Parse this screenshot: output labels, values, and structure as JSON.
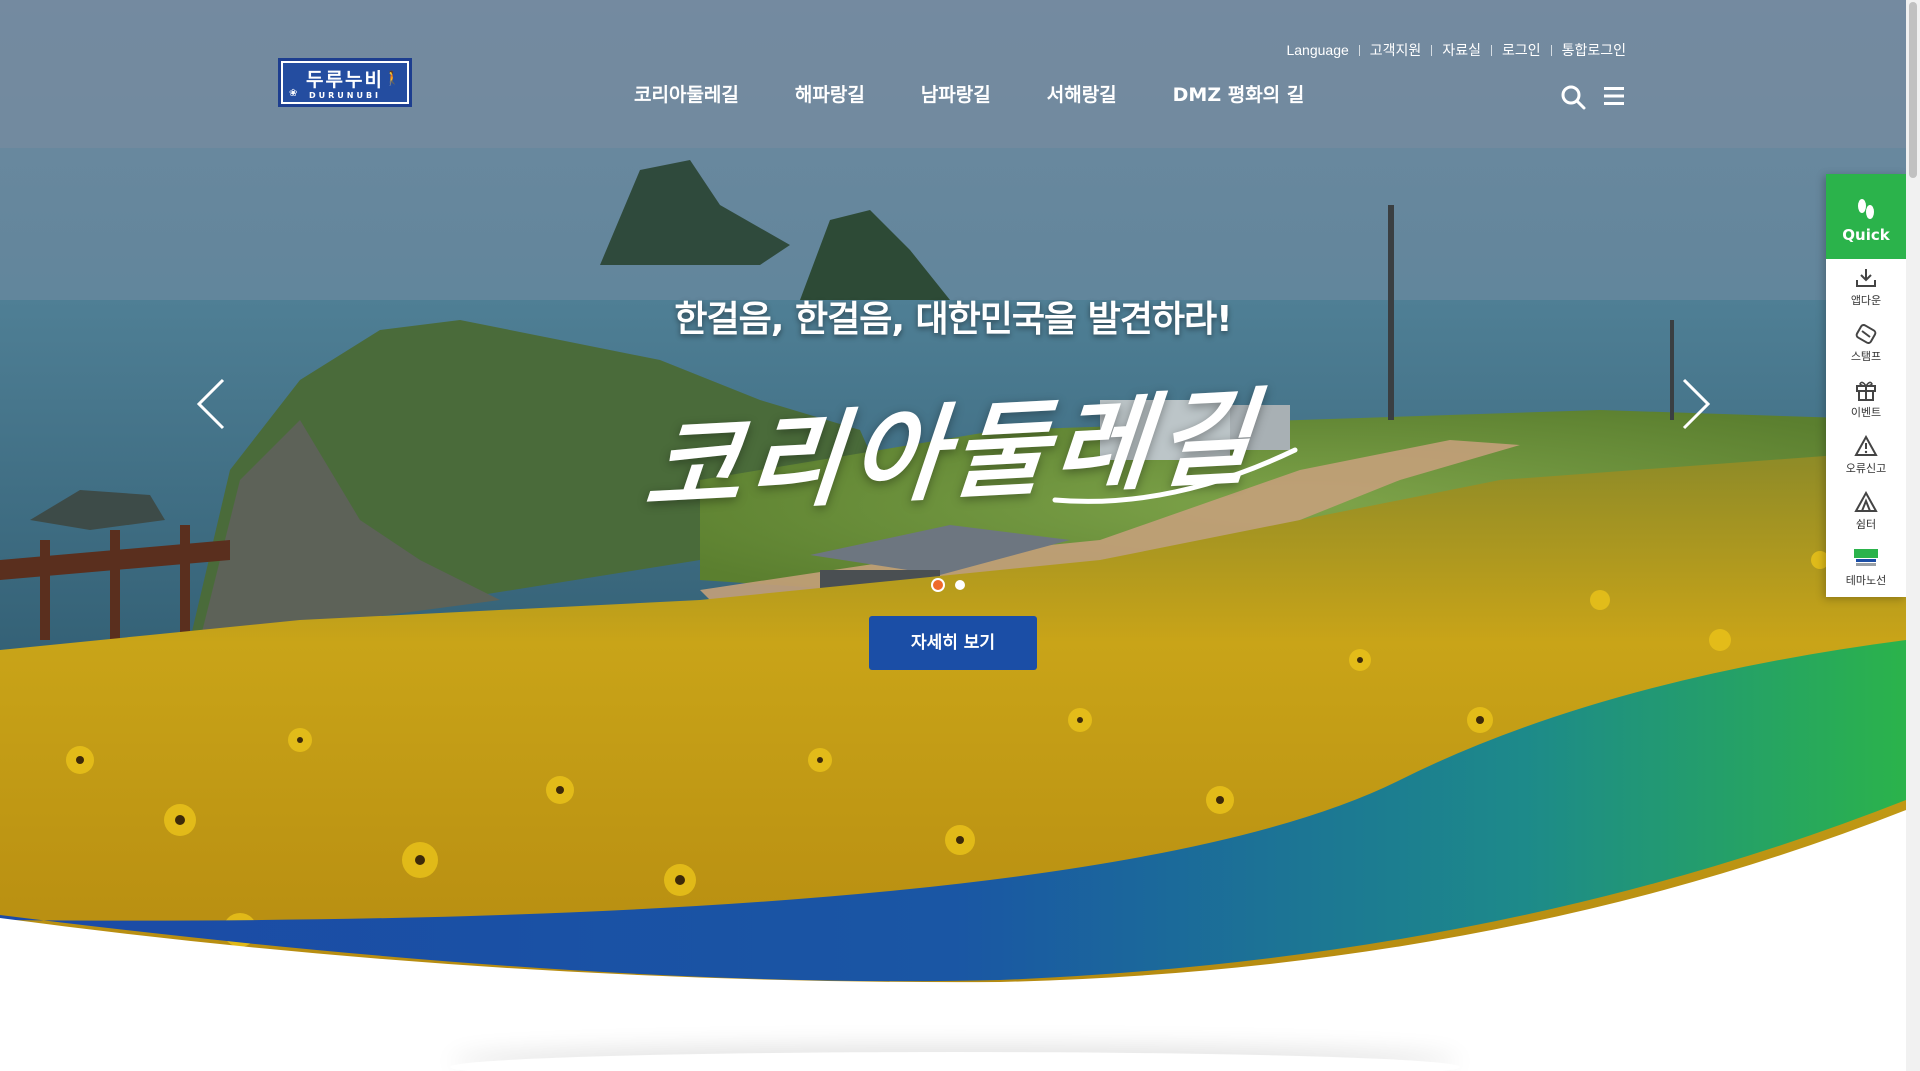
{
  "brand": {
    "logo_title": "두루누비",
    "logo_sub": "DURUNUBI",
    "colors": {
      "primary_blue": "#1b4ea6",
      "green": "#2bb34b",
      "accent_orange": "#ef6a2a"
    }
  },
  "util_links": [
    {
      "label": "Language"
    },
    {
      "label": "고객지원"
    },
    {
      "label": "자료실"
    },
    {
      "label": "로그인"
    },
    {
      "label": "통합로그인"
    }
  ],
  "gnb": [
    {
      "label": "코리아둘레길"
    },
    {
      "label": "해파랑길"
    },
    {
      "label": "남파랑길"
    },
    {
      "label": "서해랑길"
    },
    {
      "label": "DMZ 평화의 길"
    }
  ],
  "header_icons": {
    "search": "search-icon",
    "menu": "hamburger-menu-icon"
  },
  "hero": {
    "tagline": "한걸음, 한걸음, 대한민국을 발견하라!",
    "headline": "코리아둘레길",
    "button_label": "자세히 보기",
    "slide_count": 2,
    "active_slide": 1
  },
  "quick_menu": {
    "title": "Quick",
    "items": [
      {
        "label": "앱다운",
        "icon": "download-icon"
      },
      {
        "label": "스탬프",
        "icon": "stamp-icon"
      },
      {
        "label": "이벤트",
        "icon": "gift-icon"
      },
      {
        "label": "오류신고",
        "icon": "warning-icon"
      },
      {
        "label": "쉼터",
        "icon": "shelter-icon"
      },
      {
        "label": "테마노선",
        "icon": "theme-route-icon"
      }
    ]
  }
}
